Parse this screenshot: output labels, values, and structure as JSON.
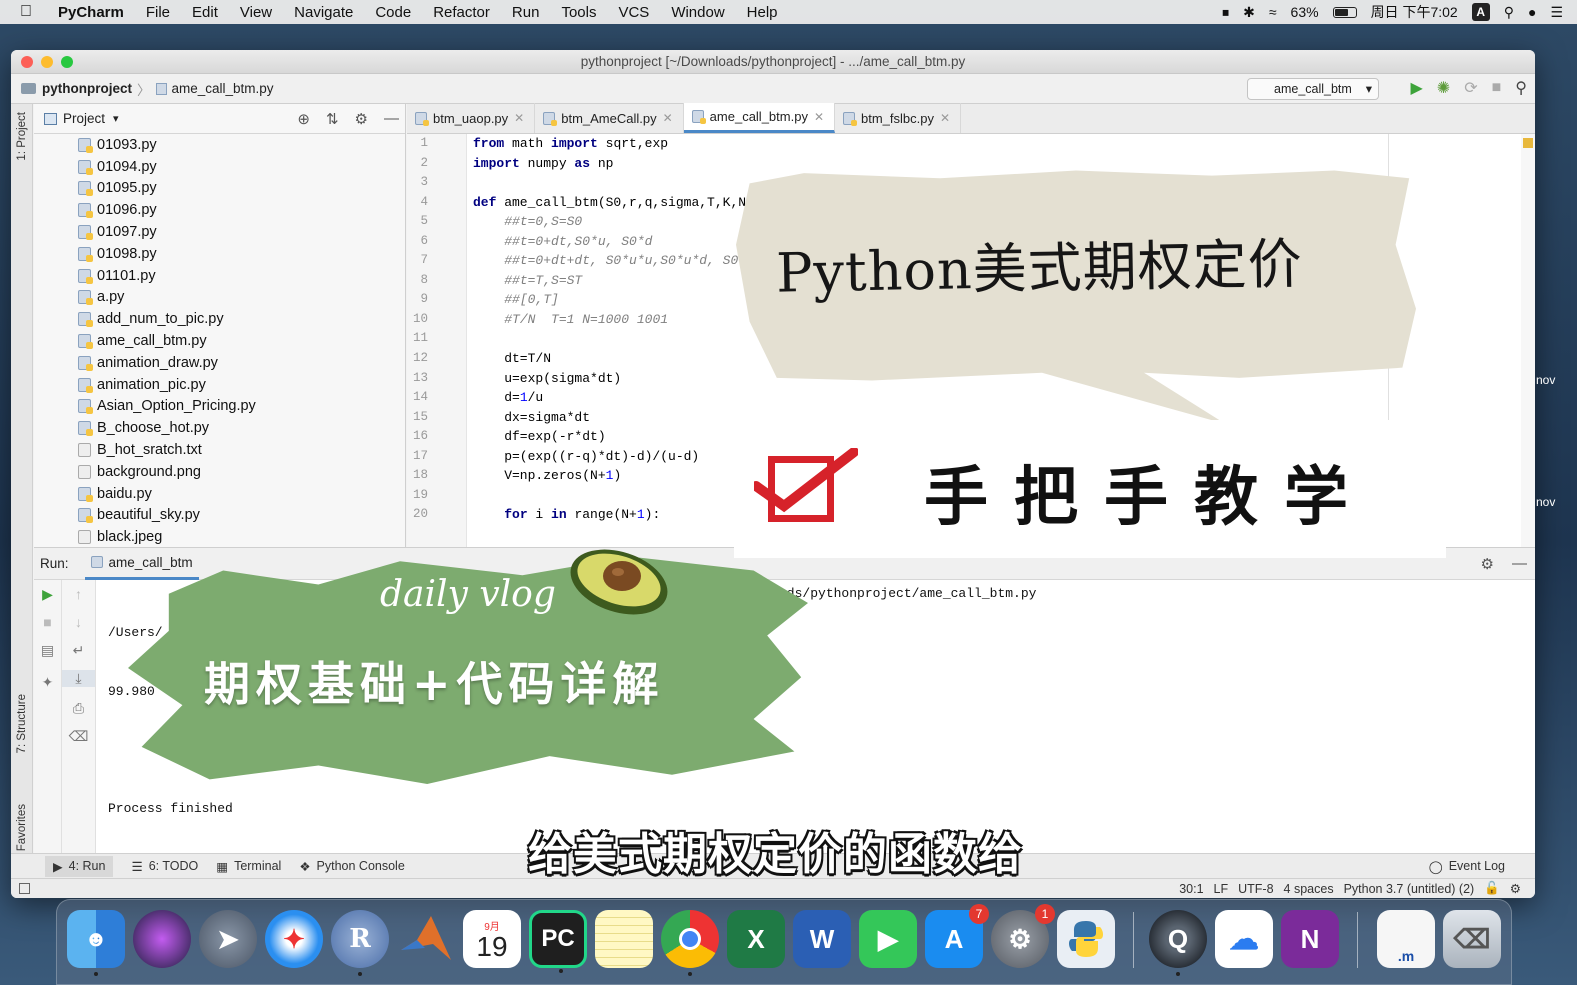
{
  "menubar": {
    "app": "PyCharm",
    "items": [
      "File",
      "Edit",
      "View",
      "Navigate",
      "Code",
      "Refactor",
      "Run",
      "Tools",
      "VCS",
      "Window",
      "Help"
    ],
    "battery": "63%",
    "battery_level": 0.63,
    "clock": "周日 下午7:02",
    "input_indicator": "A"
  },
  "window": {
    "title": "pythonproject [~/Downloads/pythonproject] - .../ame_call_btm.py"
  },
  "navbar": {
    "project": "pythonproject",
    "file": "ame_call_btm.py",
    "run_config": "ame_call_btm"
  },
  "sidebar": {
    "project_tab": "1: Project",
    "structure_tab": "7: Structure",
    "favorites_tab": "2: Favorites"
  },
  "project_panel": {
    "title": "Project",
    "files": [
      {
        "name": "01093.py",
        "type": "py"
      },
      {
        "name": "01094.py",
        "type": "py"
      },
      {
        "name": "01095.py",
        "type": "py"
      },
      {
        "name": "01096.py",
        "type": "py"
      },
      {
        "name": "01097.py",
        "type": "py"
      },
      {
        "name": "01098.py",
        "type": "py"
      },
      {
        "name": "01101.py",
        "type": "py"
      },
      {
        "name": "a.py",
        "type": "py"
      },
      {
        "name": "add_num_to_pic.py",
        "type": "py"
      },
      {
        "name": "ame_call_btm.py",
        "type": "py"
      },
      {
        "name": "animation_draw.py",
        "type": "py"
      },
      {
        "name": "animation_pic.py",
        "type": "py"
      },
      {
        "name": "Asian_Option_Pricing.py",
        "type": "py"
      },
      {
        "name": "B_choose_hot.py",
        "type": "py"
      },
      {
        "name": "B_hot_sratch.txt",
        "type": "txt"
      },
      {
        "name": "background.png",
        "type": "img"
      },
      {
        "name": "baidu.py",
        "type": "py"
      },
      {
        "name": "beautiful_sky.py",
        "type": "py"
      },
      {
        "name": "black.jpeg",
        "type": "img"
      }
    ]
  },
  "editor": {
    "tabs": [
      {
        "label": "btm_uaop.py",
        "active": false
      },
      {
        "label": "btm_AmeCall.py",
        "active": false
      },
      {
        "label": "ame_call_btm.py",
        "active": true
      },
      {
        "label": "btm_fslbc.py",
        "active": false
      }
    ],
    "line_numbers": [
      "1",
      "2",
      "3",
      "4",
      "5",
      "6",
      "7",
      "8",
      "9",
      "10",
      "11",
      "12",
      "13",
      "14",
      "15",
      "16",
      "17",
      "18",
      "19",
      "20"
    ]
  },
  "run": {
    "label": "Run:",
    "tab": "ame_call_btm",
    "line1": "/Users/",
    "line2": "99.980",
    "line3": "Process finished",
    "path": "ownloads/pythonproject/ame_call_btm.py"
  },
  "bottom_tabs": {
    "run": "4: Run",
    "todo": "6: TODO",
    "terminal": "Terminal",
    "console": "Python Console",
    "event_log": "Event Log"
  },
  "statusbar": {
    "position": "30:1",
    "line_sep": "LF",
    "encoding": "UTF-8",
    "indent": "4 spaces",
    "interpreter": "Python 3.7 (untitled) (2)"
  },
  "overlay": {
    "paper_title": "Python美式期权定价",
    "white_caption": "手把手教学",
    "vlog": "daily vlog",
    "green_title": "期权基础+代码详解",
    "subtitle": "给美式期权定价的函数给",
    "side_right": "nov"
  },
  "dock": {
    "calendar_month": "9月",
    "calendar_day": "19",
    "appstore_badge": "7",
    "prefs_badge": "1",
    "r_label": "R",
    "pc_label": "PC",
    "file_label": ".m"
  },
  "colors": {
    "accent": "#4a88c7",
    "run_green": "#3da33a",
    "stop_red": "#d6222a"
  }
}
